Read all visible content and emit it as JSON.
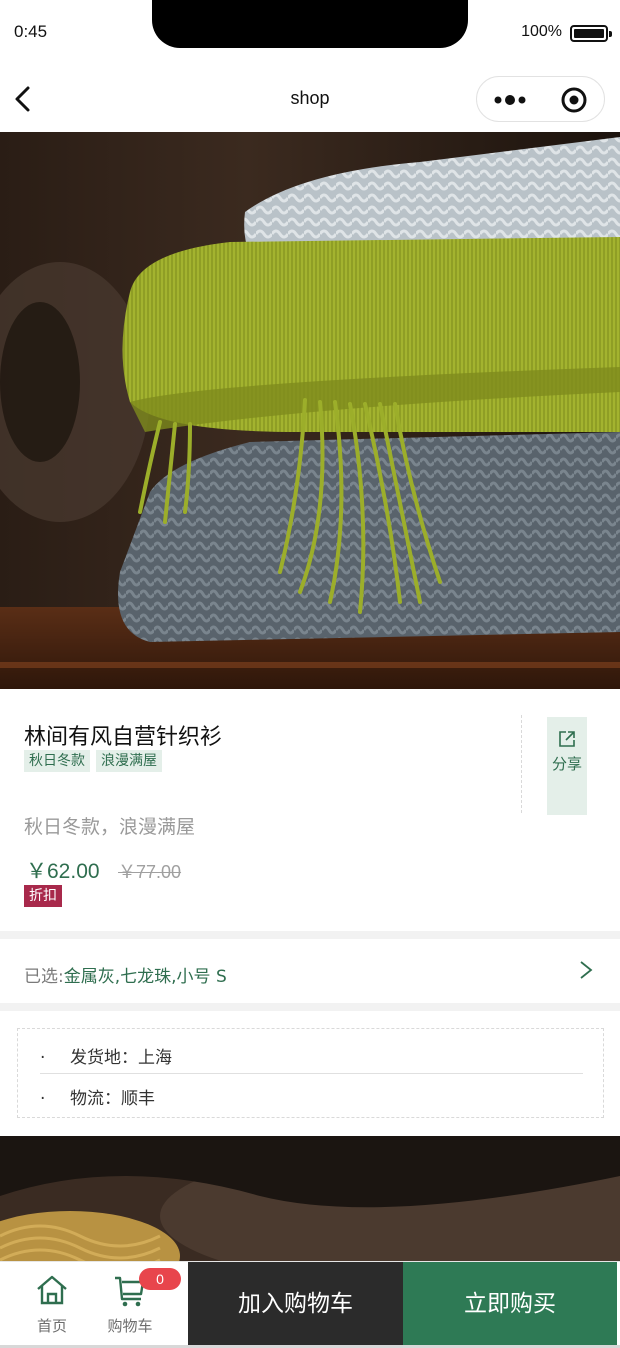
{
  "status_bar": {
    "time": "0:45",
    "battery": "100%"
  },
  "nav": {
    "title": "shop"
  },
  "product": {
    "title": "林间有风自营针织衫",
    "tags": [
      "秋日冬款",
      "浪漫满屋"
    ],
    "share_label": "分享",
    "subtitle": "秋日冬款，浪漫满屋",
    "price": "￥62.00",
    "original_price": "￥77.00",
    "discount_label": "折扣"
  },
  "selection": {
    "label": "已选:",
    "value": "金属灰,七龙珠,小号 S"
  },
  "shipping": {
    "items": [
      "发货地：上海",
      "物流：顺丰"
    ],
    "bullet": "·"
  },
  "bottom_bar": {
    "home_label": "首页",
    "cart_label": "购物车",
    "cart_count": "0",
    "add_to_cart": "加入购物车",
    "buy_now": "立即购买"
  },
  "colors": {
    "accent_green": "#2e7a55",
    "tag_bg": "#e4efe9",
    "discount_red": "#a8294b",
    "badge_red": "#e8454c",
    "dark_button": "#2b2b2b"
  },
  "icons": [
    "back-icon",
    "more-dots-icon",
    "target-icon",
    "share-icon",
    "chevron-right-icon",
    "home-icon",
    "cart-icon"
  ]
}
